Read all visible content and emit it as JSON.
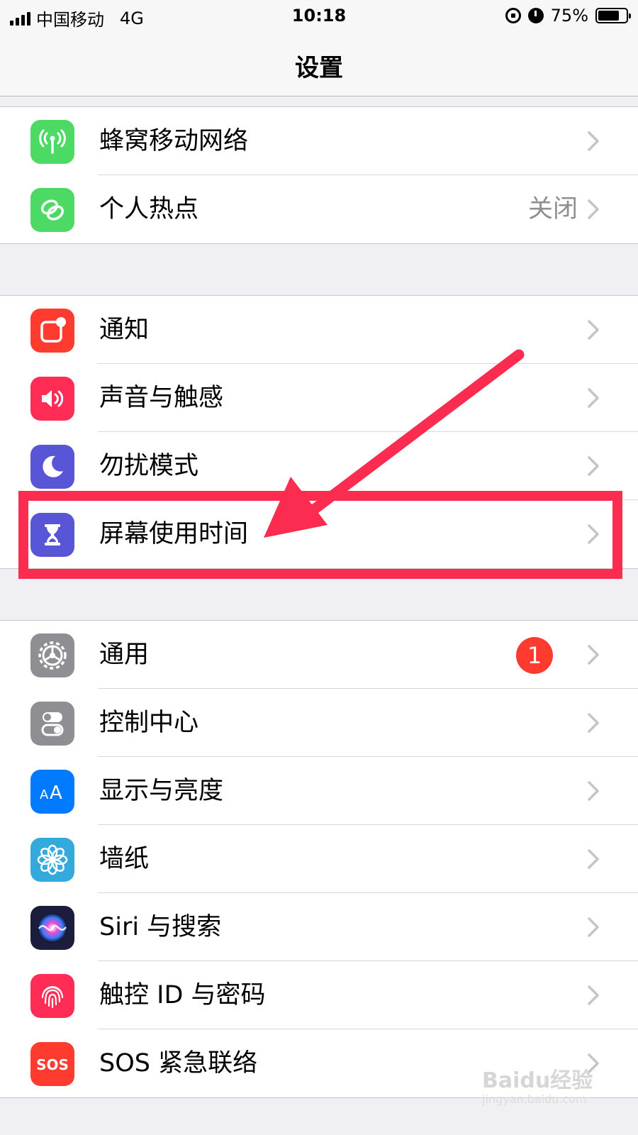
{
  "status": {
    "carrier": "中国移动",
    "network": "4G",
    "time": "10:18",
    "battery": "75%",
    "battery_level": 0.75
  },
  "nav": {
    "title": "设置"
  },
  "groups": [
    [
      {
        "label": "蜂窝移动网络",
        "icon": "cellular-antenna-icon",
        "color": "#4cd964"
      },
      {
        "label": "个人热点",
        "value": "关闭",
        "icon": "hotspot-link-icon",
        "color": "#4cd964"
      }
    ],
    [
      {
        "label": "通知",
        "icon": "notification-icon",
        "color": "#ff3b30"
      },
      {
        "label": "声音与触感",
        "icon": "speaker-icon",
        "color": "#ff2d55"
      },
      {
        "label": "勿扰模式",
        "icon": "moon-icon",
        "color": "#5856d6"
      },
      {
        "label": "屏幕使用时间",
        "icon": "hourglass-icon",
        "color": "#5856d6"
      }
    ],
    [
      {
        "label": "通用",
        "badge": "1",
        "icon": "gear-icon",
        "color": "#8e8e93"
      },
      {
        "label": "控制中心",
        "icon": "toggles-icon",
        "color": "#8e8e93"
      },
      {
        "label": "显示与亮度",
        "icon": "text-size-icon",
        "color": "#007aff"
      },
      {
        "label": "墙纸",
        "icon": "flower-icon",
        "color": "#34aadc"
      },
      {
        "label": "Siri 与搜索",
        "icon": "siri-icon",
        "color": "#1c1c3c"
      },
      {
        "label": "触控 ID 与密码",
        "icon": "fingerprint-icon",
        "color": "#ff2d55"
      },
      {
        "label": "SOS 紧急联络",
        "icon": "sos-icon",
        "color": "#ff3b30"
      }
    ]
  ],
  "annotation": {
    "highlight_color": "#fb2c4f"
  },
  "watermark": {
    "main": "Baidu经验",
    "sub": "jingyan.baidu.com"
  }
}
